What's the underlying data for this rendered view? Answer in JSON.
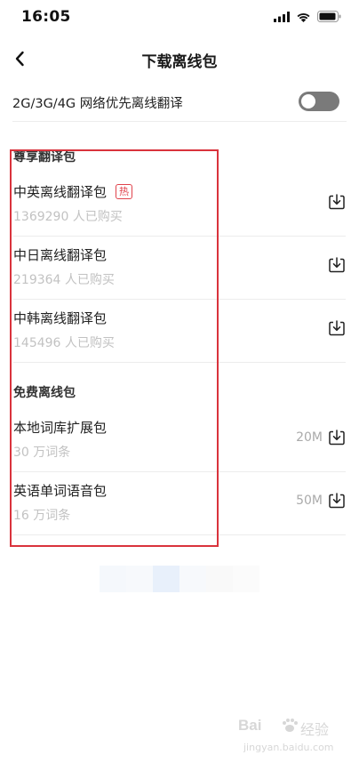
{
  "status": {
    "time": "16:05"
  },
  "nav": {
    "title": "下载离线包"
  },
  "network_toggle": {
    "label": "2G/3G/4G 网络优先离线翻译",
    "enabled": false
  },
  "premium_section": {
    "title": "尊享翻译包",
    "items": [
      {
        "name": "中英离线翻译包",
        "badge": "热",
        "subtitle": "1369290 人已购买"
      },
      {
        "name": "中日离线翻译包",
        "subtitle": "219364 人已购买"
      },
      {
        "name": "中韩离线翻译包",
        "subtitle": "145496 人已购买"
      }
    ]
  },
  "free_section": {
    "title": "免费离线包",
    "items": [
      {
        "name": "本地词库扩展包",
        "subtitle": "30 万词条",
        "size": "20M"
      },
      {
        "name": "英语单词语音包",
        "subtitle": "16 万词条",
        "size": "50M"
      }
    ]
  },
  "watermark": {
    "logo_text": "Bai",
    "brand_text": "经验",
    "url": "jingyan.baidu.com"
  },
  "colors": {
    "highlight_border": "#d9333c",
    "hot_badge": "#e0424b",
    "toggle_off": "#7a7a7a"
  }
}
